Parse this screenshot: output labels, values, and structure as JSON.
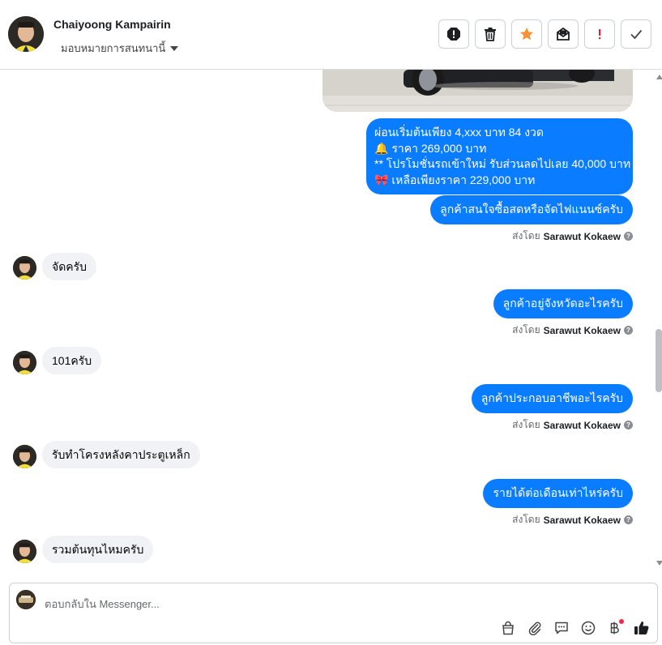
{
  "header": {
    "contact_name": "Chaiyoong Kampairin",
    "assign_label": "มอบหมายการสนทนานี้",
    "actions": [
      {
        "name": "spam-icon",
        "label": "!"
      },
      {
        "name": "trash-icon",
        "label": ""
      },
      {
        "name": "star-icon",
        "label": ""
      },
      {
        "name": "mark-unread-icon",
        "label": ""
      },
      {
        "name": "priority-icon",
        "label": "!"
      },
      {
        "name": "check-icon",
        "label": ""
      }
    ]
  },
  "chat": {
    "promo_lines": [
      "ผ่อนเริ่มต้นเพียง 4,xxx บาท 84 งวด",
      "🔔 ราคา 269,000 บาท",
      "** โปรโมชั่นรถเข้าใหม่ รับส่วนลดไปเลย 40,000 บาท",
      "🎀  เหลือเพียงราคา 229,000 บาท"
    ],
    "sent_by_prefix": "ส่งโดย",
    "agent_name": "Sarawut Kokaew",
    "outgoing": [
      "ลูกค้าสนใจซื้อสดหรือจัดไฟแนนซ์ครับ",
      "ลูกค้าอยู่จังหวัดอะไรครับ",
      "ลูกค้าประกอบอาชีพอะไรครับ",
      "รายได้ต่อเดือนเท่าไหร่ครับ"
    ],
    "incoming": [
      "จัดครับ",
      "101ครับ",
      "รับทำโครงหลังคาประตูเหล็ก",
      "รวมต้นทุนไหมครับ"
    ]
  },
  "composer": {
    "placeholder": "ตอบกลับใน Messenger...",
    "tools": [
      "shopping-bag-icon",
      "attach-icon",
      "saved-replies-icon",
      "emoji-icon",
      "baht-icon",
      "like-icon"
    ]
  },
  "colors": {
    "outgoing_bubble": "#0a7cff",
    "incoming_bubble": "#f0f2f5",
    "star": "#f7923a",
    "priority": "#e41e3f"
  }
}
